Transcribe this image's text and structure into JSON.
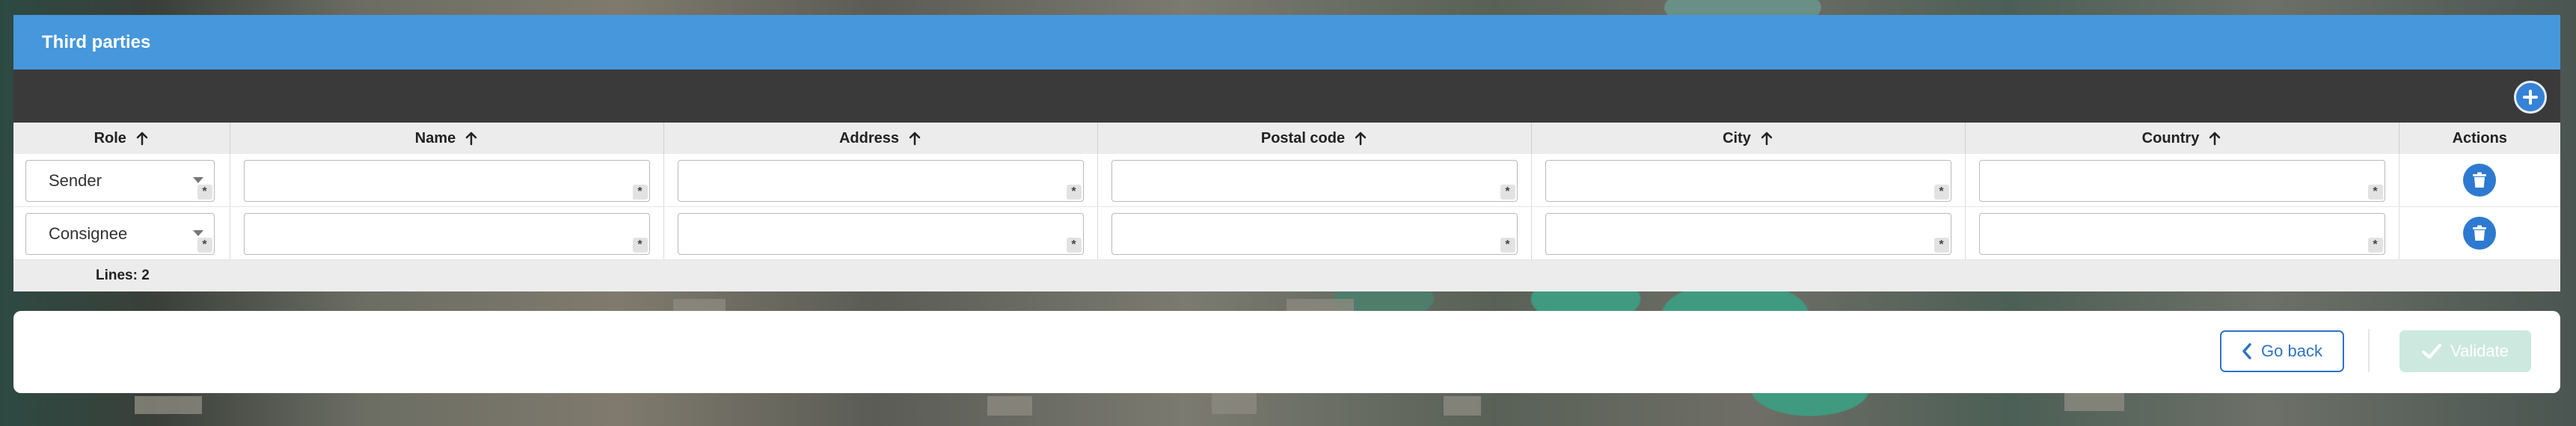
{
  "panel": {
    "title": "Third parties"
  },
  "table": {
    "columns": [
      "Role",
      "Name",
      "Address",
      "Postal code",
      "City",
      "Country",
      "Actions"
    ],
    "rows": [
      {
        "role": "Sender",
        "name": "",
        "address": "",
        "postal_code": "",
        "city": "",
        "country": ""
      },
      {
        "role": "Consignee",
        "name": "",
        "address": "",
        "postal_code": "",
        "city": "",
        "country": ""
      }
    ],
    "required_marker": "*",
    "lines_label": "Lines: 2"
  },
  "actions": {
    "back_label": "Go back",
    "validate_label": "Validate"
  },
  "colors": {
    "header": "#4697db",
    "toolbar": "#3a3a3a",
    "accent": "#2f73c4",
    "validate_disabled": "#cde9df"
  },
  "icons": {
    "add": "plus-icon",
    "sort": "arrow-up-icon",
    "delete": "trash-icon",
    "back": "chevron-left-icon",
    "validate": "check-icon",
    "dropdown": "caret-down-icon"
  }
}
